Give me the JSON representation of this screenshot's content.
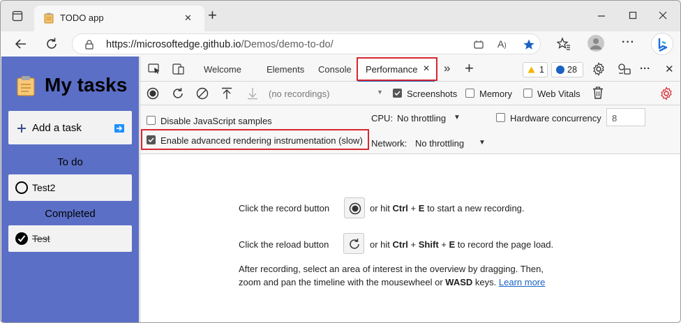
{
  "browser": {
    "tab_title": "TODO app",
    "url_host": "https://microsoftedge.github.io",
    "url_path": "/Demos/demo-to-do/",
    "new_tab_symbol": "+",
    "close_symbol": "✕",
    "more_symbol": "···"
  },
  "app": {
    "title": "My tasks",
    "add_task_label": "Add a task",
    "todo_heading": "To do",
    "todo_items": [
      "Test2"
    ],
    "completed_heading": "Completed",
    "completed_items": [
      "Test"
    ]
  },
  "devtools": {
    "tabs": [
      "Welcome",
      "Elements",
      "Console",
      "Performance"
    ],
    "active_tab": "Performance",
    "warnings_count": "1",
    "messages_count": "28",
    "recordings_placeholder": "(no recordings)",
    "screenshots_label": "Screenshots",
    "memory_label": "Memory",
    "web_vitals_label": "Web Vitals",
    "disable_js_label": "Disable JavaScript samples",
    "advanced_rendering_label": "Enable advanced rendering instrumentation (slow)",
    "cpu_label": "CPU:",
    "cpu_value": "No throttling",
    "network_label": "Network:",
    "network_value": "No throttling",
    "hw_concurrency_label": "Hardware concurrency",
    "hw_concurrency_value": "8",
    "hint_record_pre": "Click the record button",
    "hint_record_mid": "or hit",
    "hint_record_k1": "Ctrl",
    "hint_plus": "+",
    "hint_record_k2": "E",
    "hint_record_post": "to start a new recording.",
    "hint_reload_pre": "Click the reload button",
    "hint_reload_mid": "or hit",
    "hint_reload_k1": "Ctrl",
    "hint_reload_k2": "Shift",
    "hint_reload_k3": "E",
    "hint_reload_post": "to record the page load.",
    "hint_after_line1": "After recording, select an area of interest in the overview by dragging. Then,",
    "hint_after_line2_pre": "zoom and pan the timeline with the mousewheel or",
    "hint_after_wasd": "WASD",
    "hint_after_keys": "keys.",
    "learn_more": "Learn more"
  },
  "colors": {
    "app_bg": "#5b6fc6",
    "highlight_red": "#d8262e",
    "accent_blue": "#1a62c2"
  }
}
